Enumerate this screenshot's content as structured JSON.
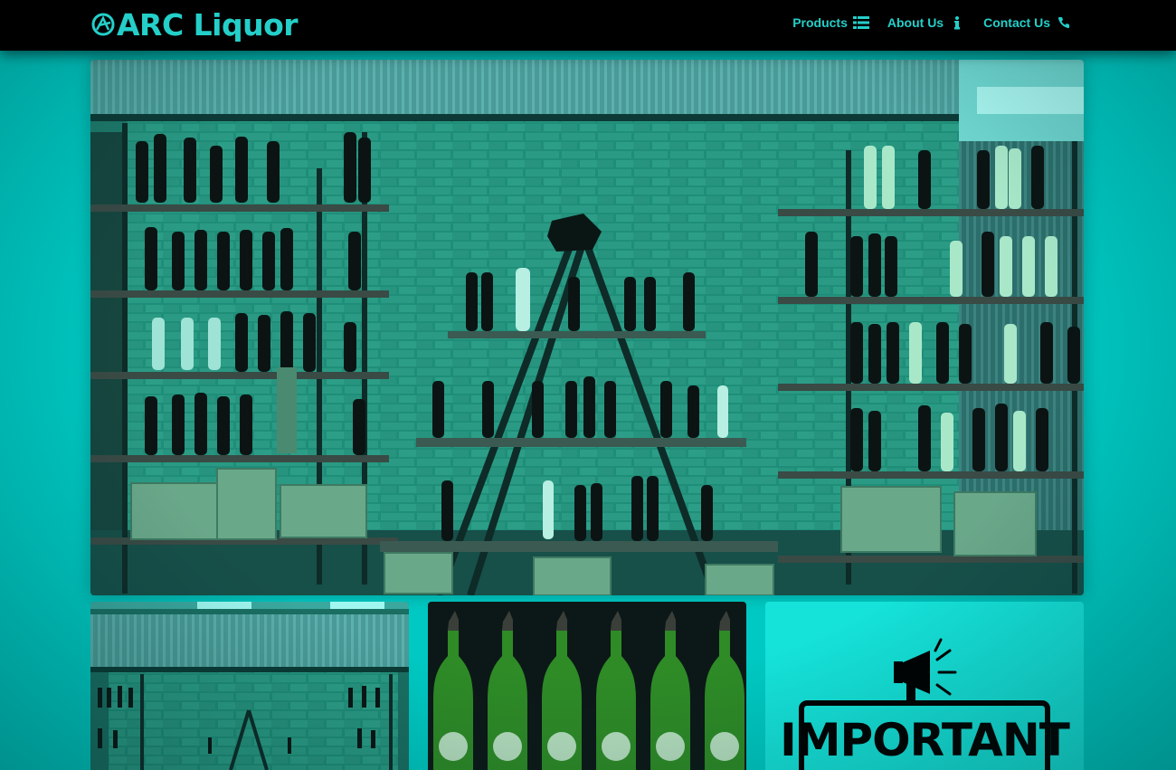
{
  "brand": {
    "name": "ARC Liquor",
    "logo_icon": "arc-emblem-icon"
  },
  "nav": {
    "items": [
      {
        "label": "Products",
        "icon": "list-icon"
      },
      {
        "label": "About Us",
        "icon": "info-icon"
      },
      {
        "label": "Contact Us",
        "icon": "phone-icon"
      }
    ]
  },
  "hero": {
    "alt": "Wine display shelves with ladder shelf in front of brick wall"
  },
  "tiles": [
    {
      "alt": "Store interior with wine shelves"
    },
    {
      "alt": "Green glass bottles with pour spouts"
    },
    {
      "label": "IMPORTANT",
      "icon": "megaphone-icon"
    }
  ],
  "colors": {
    "accent": "#24cfc9",
    "background": "#00c9c3",
    "navbar": "#000000"
  }
}
